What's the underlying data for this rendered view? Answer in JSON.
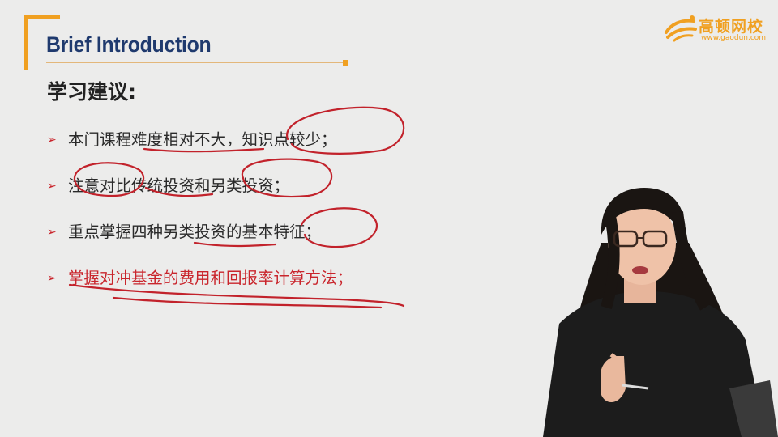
{
  "header": {
    "title": "Brief Introduction"
  },
  "logo": {
    "name": "高顿网校",
    "url": "www.gaodun.com",
    "icon": "gaodun-logo-icon",
    "color": "#f0a021"
  },
  "section": {
    "heading": "学习建议:"
  },
  "bullets": [
    {
      "text": "本门课程难度相对不大，知识点较少；",
      "highlight": false
    },
    {
      "text": "注意对比传统投资和另类投资；",
      "highlight": false
    },
    {
      "text": "重点掌握四种另类投资的基本特征；",
      "highlight": false
    },
    {
      "text": "掌握对冲基金的费用和回报率计算方法；",
      "highlight": true
    }
  ],
  "colors": {
    "accent": "#f0a021",
    "title": "#1f3a6e",
    "bullet_arrow": "#c9252c",
    "annotation_ink": "#c2222b",
    "background": "#ececeb"
  }
}
